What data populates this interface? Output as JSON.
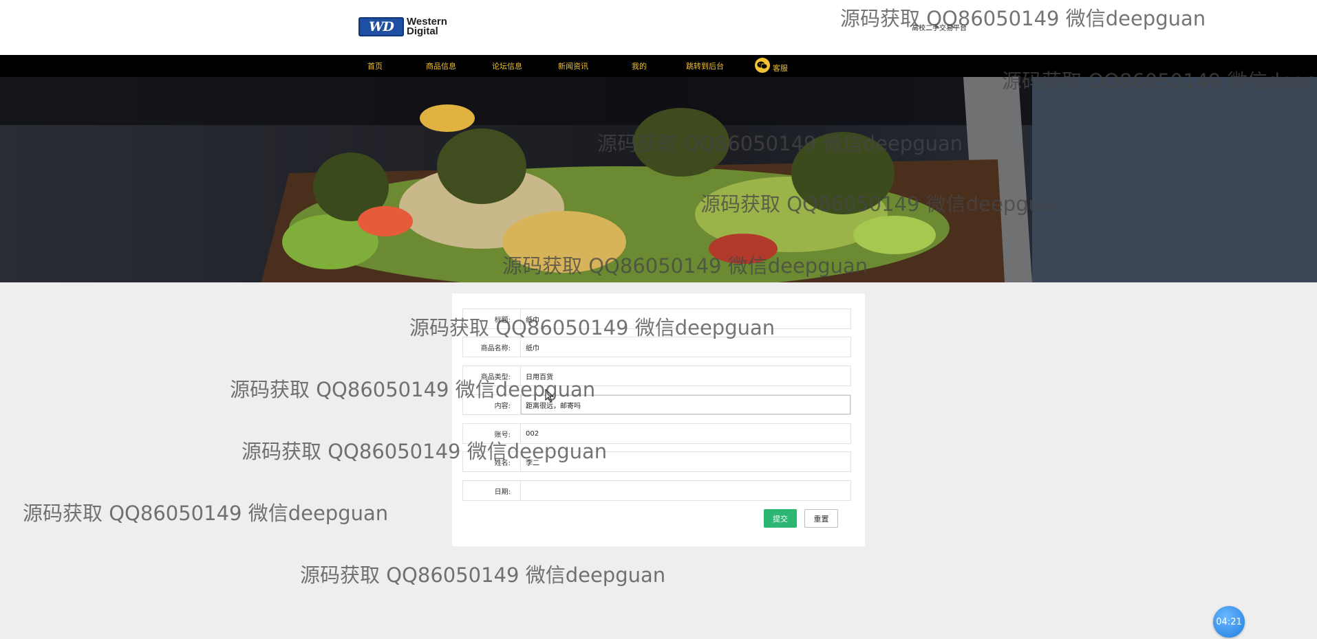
{
  "header": {
    "logo_text_line1": "Western",
    "logo_text_line2": "Digital",
    "logo_badge": "WD",
    "site_title": "高校二手交易平台"
  },
  "nav": {
    "items": [
      "首页",
      "商品信息",
      "论坛信息",
      "新闻资讯",
      "我的",
      "跳转到后台"
    ],
    "service_label": "客服",
    "service_icon": "wechat-icon",
    "text_color": "#f2c230"
  },
  "banner": {
    "image": "food-platter-banner"
  },
  "form": {
    "fields": [
      {
        "label": "标题:",
        "value": "纸巾"
      },
      {
        "label": "商品名称:",
        "value": "纸巾"
      },
      {
        "label": "商品类型:",
        "value": "日用百货"
      },
      {
        "label": "内容:",
        "value": "距离很远，邮寄吗"
      },
      {
        "label": "账号:",
        "value": "002"
      },
      {
        "label": "姓名:",
        "value": "李二"
      },
      {
        "label": "日期:",
        "value": ""
      }
    ],
    "submit_label": "提交",
    "reset_label": "重置",
    "submit_color": "#2bb673"
  },
  "watermark_text": "源码获取 QQ86050149 微信deepguan",
  "clock": {
    "time": "04:21"
  }
}
